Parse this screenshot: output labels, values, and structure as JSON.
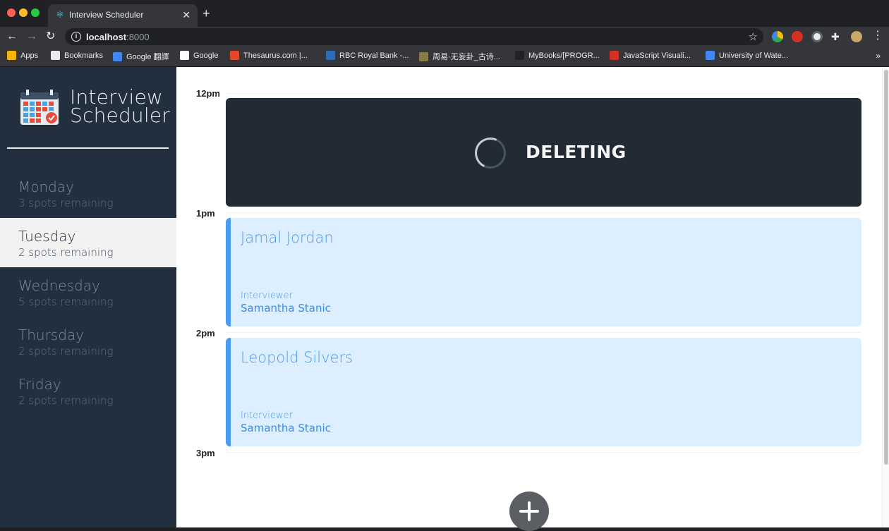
{
  "browser": {
    "tab_title": "Interview Scheduler",
    "url_host": "localhost",
    "url_port": ":8000",
    "bookmarks": [
      {
        "label": "Apps",
        "icon": "apps-grid-icon",
        "color": "#f4b400"
      },
      {
        "label": "Bookmarks",
        "icon": "star-icon",
        "color": "#e8eaed"
      },
      {
        "label": "Google 翻譯",
        "icon": "google-translate-icon",
        "color": "#4285f4"
      },
      {
        "label": "Google",
        "icon": "google-icon",
        "color": "#ffffff"
      },
      {
        "label": "Thesaurus.com |...",
        "icon": "thesaurus-icon",
        "color": "#e2492c"
      },
      {
        "label": "RBC Royal Bank -...",
        "icon": "rbc-icon",
        "color": "#2f6cb5"
      },
      {
        "label": "周易·无妄卦_古诗...",
        "icon": "book-icon",
        "color": "#8a7a4a"
      },
      {
        "label": "MyBooks/[PROGR...",
        "icon": "github-icon",
        "color": "#222222"
      },
      {
        "label": "JavaScript Visuali...",
        "icon": "js-visualizer-icon",
        "color": "#d93025"
      },
      {
        "label": "University of Wate...",
        "icon": "university-icon",
        "color": "#4285f4"
      }
    ]
  },
  "app": {
    "brand_line1": "Interview",
    "brand_line2": "Scheduler",
    "days": [
      {
        "name": "Monday",
        "spots": "3 spots remaining",
        "selected": false
      },
      {
        "name": "Tuesday",
        "spots": "2 spots remaining",
        "selected": true
      },
      {
        "name": "Wednesday",
        "spots": "5 spots remaining",
        "selected": false
      },
      {
        "name": "Thursday",
        "spots": "2 spots remaining",
        "selected": false
      },
      {
        "name": "Friday",
        "spots": "2 spots remaining",
        "selected": false
      }
    ],
    "times": [
      "12pm",
      "1pm",
      "2pm",
      "3pm"
    ],
    "status_text": "DELETING",
    "appointments": [
      {
        "student": "Jamal Jordan",
        "interviewer_label": "Interviewer",
        "interviewer": "Samantha Stanic"
      },
      {
        "student": "Leopold Silvers",
        "interviewer_label": "Interviewer",
        "interviewer": "Samantha Stanic"
      }
    ],
    "colors": {
      "sidebar": "#222f3e",
      "accent": "#4a9bf2",
      "appointment_bg": "#ddeefe",
      "status_bg": "#222a35"
    }
  }
}
